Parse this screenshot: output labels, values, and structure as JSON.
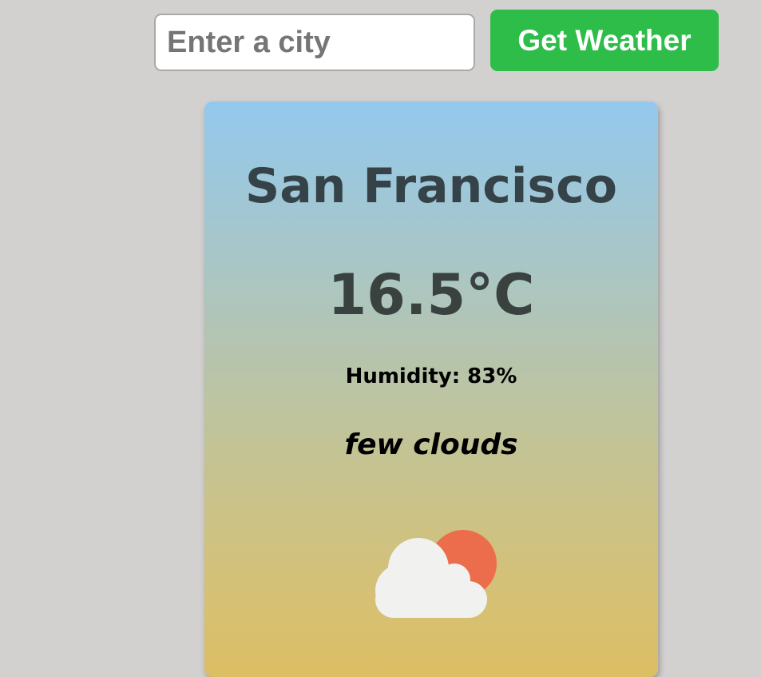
{
  "search": {
    "placeholder": "Enter a city",
    "value": ""
  },
  "toolbar": {
    "submit_label": "Get Weather"
  },
  "weather": {
    "city": "San Francisco",
    "temperature": "16.5°C",
    "humidity": "Humidity: 83%",
    "description": "few clouds",
    "icon": "few-clouds-icon"
  },
  "colors": {
    "button": "#2dbd48",
    "background": "#d3d1d0",
    "sun": "#ec6d4b",
    "cloud": "#f1f1f0"
  }
}
